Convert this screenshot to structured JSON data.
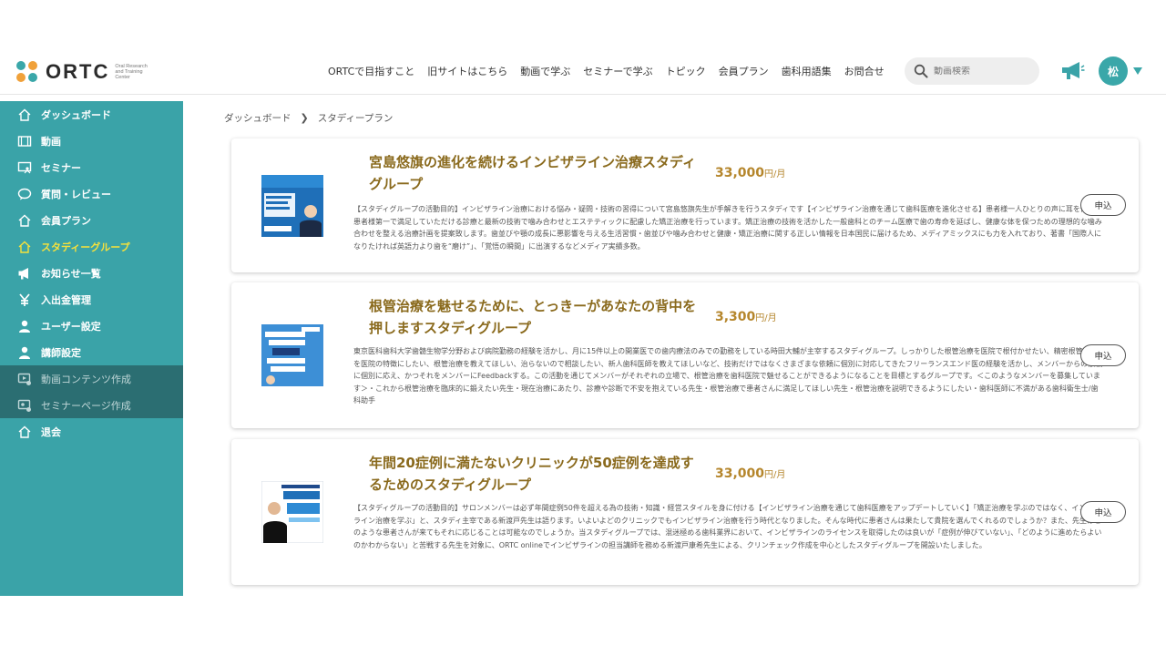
{
  "header": {
    "logo_text": "ORTC",
    "logo_sub": "Oral Research and Training Center",
    "nav": [
      "ORTCで目指すこと",
      "旧サイトはこちら",
      "動画で学ぶ",
      "セミナーで学ぶ",
      "トピック",
      "会員プラン",
      "歯科用語集",
      "お問合せ"
    ],
    "search_placeholder": "動画検索",
    "avatar_initial": "松"
  },
  "sidebar": {
    "items": [
      {
        "label": "ダッシュボード",
        "icon": "home-icon"
      },
      {
        "label": "動画",
        "icon": "film-icon"
      },
      {
        "label": "セミナー",
        "icon": "presentation-icon"
      },
      {
        "label": "質問・レビュー",
        "icon": "chat-icon"
      },
      {
        "label": "会員プラン",
        "icon": "home-icon"
      },
      {
        "label": "スタディーグループ",
        "icon": "home-icon"
      },
      {
        "label": "お知らせ一覧",
        "icon": "megaphone-icon"
      },
      {
        "label": "入出金管理",
        "icon": "yen-icon"
      },
      {
        "label": "ユーザー設定",
        "icon": "user-icon"
      },
      {
        "label": "講師設定",
        "icon": "user-icon"
      },
      {
        "label": "動画コンテンツ作成",
        "icon": "video-edit-icon"
      },
      {
        "label": "セミナーページ作成",
        "icon": "seminar-edit-icon"
      },
      {
        "label": "退会",
        "icon": "home-icon"
      }
    ],
    "active_index": 5
  },
  "breadcrumb": [
    "ダッシュボード",
    "スタディープラン"
  ],
  "apply_label": "申込",
  "cards": [
    {
      "title": "宮島悠旗の進化を続けるインビザライン治療スタディグループ",
      "price": "33,000",
      "unit": "円/月",
      "description": "【スタディグループの活動目的】インビザライン治療における悩み・疑問・技術の習得について宮島悠旗先生が手解きを行うスタディです【インビザライン治療を通じて歯科医療を進化させる】患者様一人ひとりの声に耳を傾け、患者様第一で満足していただける診療と最新の技術で噛み合わせとエステティックに配慮した矯正治療を行っています。矯正治療の技術を活かした一般歯科とのチーム医療で歯の寿命を延ばし、健康な体を保つための理想的な噛み合わせを整える治療計画を提案致します。歯並びや顎の成長に悪影響を与える生活習慣・歯並びや噛み合わせと健康・矯正治療に関する正しい情報を日本国民に届けるため、メディアミックスにも力を入れており、著書「国際人になりたければ英語力より歯を“磨け”」、「覚悟の瞬間」に出演するなどメディア実績多数。"
    },
    {
      "title": "根管治療を魅せるために、とっきーがあなたの背中を押しますスタディグループ",
      "price": "3,300",
      "unit": "円/月",
      "description": "東京医科歯科大学歯髄生物学分野および病院勤務の経験を活かし、月に15件以上の開業医での歯内療法のみでの勤務をしている時田大輔が主宰するスタディグループ。しっかりした根管治療を医院で根付かせたい、精密根管治療を医院の特徴にしたい、根管治療を教えてほしい、治らないので相談したい、新人歯科医師を教えてほしいなど、技術だけではなくさまざまな依頼に個別に対応してきたフリーランスエンド医の経験を活かし、メンバーからの依頼に個別に応え、かつそれをメンバーにFeedbackする。この活動を通じてメンバーがそれぞれの立場で、根管治療を歯科医院で魅せることができるようになることを目標とするグループです。＜このようなメンバーを募集しています＞・これから根管治療を臨床的に鍛えたい先生・現在治療にあたり、診療や診断で不安を抱えている先生・根管治療で患者さんに満足してほしい先生・根管治療を説明できるようにしたい・歯科医師に不満がある歯科衛生士/歯科助手"
    },
    {
      "title": "年間20症例に満たないクリニックが50症例を達成するためのスタディグループ",
      "price": "33,000",
      "unit": "円/月",
      "description": "【スタディグループの活動目的】サロンメンバーは必ず年間症例50件を超える為の技術・知識・経営スタイルを身に付ける【インビザライン治療を通じて歯科医療をアップデートしていく】「矯正治療を学ぶのではなく、インビザライン治療を学ぶ」と、スタディ主宰である新渡戸先生は語ります。いよいよどのクリニックでもインビザライン治療を行う時代となりました。そんな時代に患者さんは果たして貴院を選んでくれるのでしょうか？また、先生はどのような患者さんが来てもそれに応じることは可能なのでしょうか。当スタディグループでは、混迷極める歯科業界において、インビザラインのライセンスを取得したのは良いが「症例が伸びていない」、「どのように進めたらよいのかわからない」と苦戦する先生を対象に、ORTC onlineでインビザラインの担当講師を務める新渡戸康希先生による、クリンチェック作成を中心としたスタディグループを開設いたしました。"
    }
  ],
  "thumbnails": [
    {
      "label": "インビザライン治療スタディグループ",
      "bg": "#2a7fc4"
    },
    {
      "label": "根管治療を魅せるために とっきーがあなたの背中を押しますグループ",
      "bg": "#3d8fd6"
    },
    {
      "label": "50症例達成 スタディグループ",
      "bg": "#ffffff"
    }
  ],
  "colors": {
    "accent": "#3aa3a8",
    "active": "#f6e13b",
    "title": "#8a6a1d",
    "price": "#b5862c"
  }
}
